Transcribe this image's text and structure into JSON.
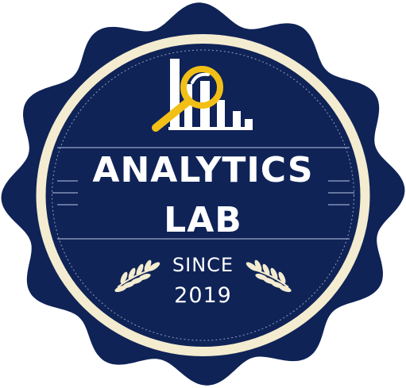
{
  "badge": {
    "title_line1": "ANALYTICS",
    "title_line2": "LAB",
    "since_label": "SINCE",
    "since_year": "2019",
    "logo_icon": "magnifier-bar-chart-icon",
    "laurel_icon": "laurel-branch-icon"
  },
  "colors": {
    "navy": "#0f2357",
    "cream": "#f4ecd0",
    "gold": "#f2bf16",
    "white": "#ffffff"
  }
}
